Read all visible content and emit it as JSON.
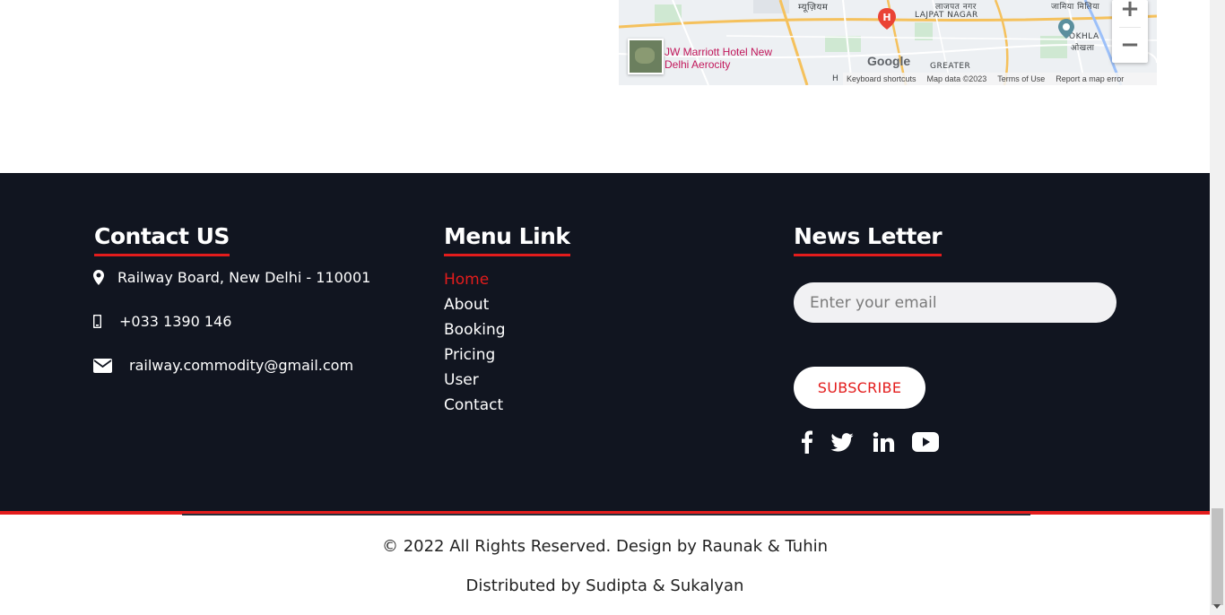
{
  "map": {
    "labels": {
      "lajpat_en": "LAJPAT NAGAR",
      "lajpat_hi": "लाजपत नगर",
      "museum_hi": "म्यूज़ियम",
      "okhla_en": "OKHLA",
      "okhla_hi": "ओखला",
      "jamia_hi": "जामिया मिलिया",
      "greater": "GREATER",
      "h_label": "H",
      "hospital_hi": "एम्स हॉस्पिटल"
    },
    "hotel": "JW Marriott Hotel New Delhi Aerocity",
    "google_logo": "Google",
    "footer_links": [
      "Keyboard shortcuts",
      "Map data ©2023",
      "Terms of Use",
      "Report a map error"
    ],
    "zoom_in": "+",
    "zoom_out": "−"
  },
  "contact": {
    "title": "Contact US",
    "address": "Railway Board, New Delhi - 110001",
    "phone": "+033 1390 146",
    "email": "railway.commodity@gmail.com"
  },
  "menu": {
    "title": "Menu Link",
    "items": [
      "Home",
      "About",
      "Booking",
      "Pricing",
      "User",
      "Contact"
    ],
    "active_index": 0
  },
  "newsletter": {
    "title": "News Letter",
    "email_placeholder": "Enter your email",
    "subscribe_label": "SUBSCRIBE",
    "social": [
      "facebook-icon",
      "twitter-icon",
      "linkedin-icon",
      "youtube-icon"
    ]
  },
  "bottom": {
    "copyright": "© 2022 All Rights Reserved. Design by Raunak & Tuhin",
    "distributed": "Distributed by Sudipta & Sukalyan"
  },
  "colors": {
    "footer_bg": "#111520",
    "accent": "#e31c1c",
    "text_light": "#ffffff"
  }
}
